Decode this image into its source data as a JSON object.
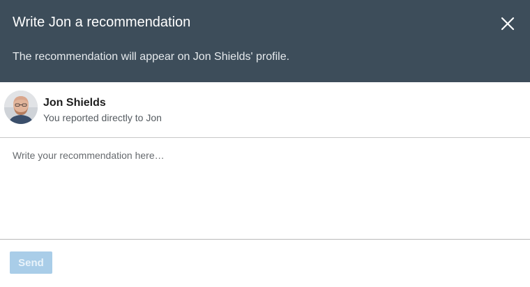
{
  "dialog": {
    "title": "Write Jon a recommendation",
    "subtitle": "The recommendation will appear on Jon Shields' profile.",
    "close_icon": "close-icon",
    "header_color": "#3d4d5a"
  },
  "recipient": {
    "name": "Jon Shields",
    "relation": "You reported directly to Jon",
    "avatar_icon": "avatar"
  },
  "editor": {
    "placeholder": "Write your recommendation here…",
    "value": ""
  },
  "actions": {
    "send_label": "Send",
    "send_color": "#a9cde8",
    "send_disabled": true
  }
}
